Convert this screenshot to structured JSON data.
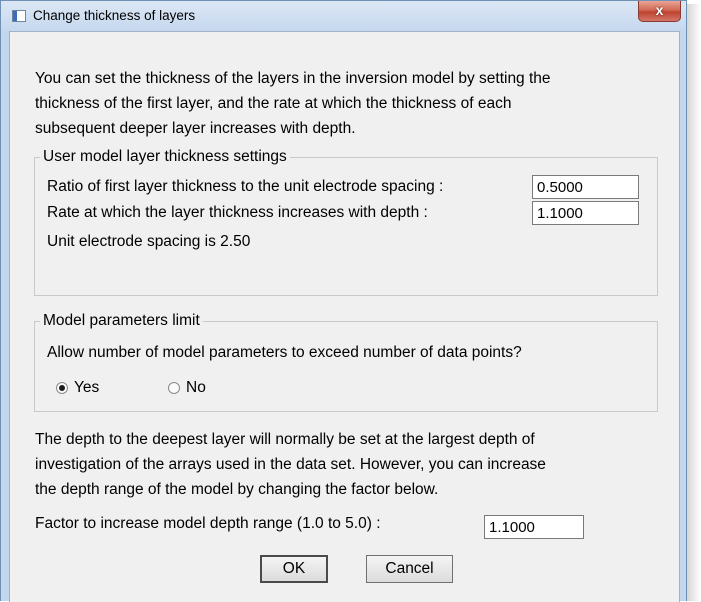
{
  "window": {
    "title": "Change thickness of layers",
    "close_glyph": "x"
  },
  "intro": [
    "You can set the thickness of the layers in the inversion model by setting the",
    "thickness of the first layer, and the rate at which the thickness of each",
    "subsequent deeper layer increases with depth."
  ],
  "thickness_group": {
    "legend": "User model layer thickness settings",
    "ratio_label": "Ratio of first layer thickness to the unit electrode spacing :",
    "ratio_value": "0.5000",
    "rate_label": "Rate at which the layer thickness increases with depth :",
    "rate_value": "1.1000",
    "spacing_text": "Unit electrode spacing is 2.50"
  },
  "params_group": {
    "legend": "Model parameters limit",
    "question": "Allow number of model parameters to exceed number of data points?",
    "options": [
      {
        "label": "Yes",
        "checked": true
      },
      {
        "label": "No",
        "checked": false
      }
    ]
  },
  "depth": [
    "The depth to the deepest layer will normally be set at the largest depth of",
    "investigation of the arrays used in the data set. However, you can increase",
    "the depth range of the model by changing the factor below."
  ],
  "factor": {
    "label": "Factor to increase model depth range (1.0 to 5.0) :",
    "value": "1.1000"
  },
  "buttons": {
    "ok": "OK",
    "cancel": "Cancel"
  }
}
